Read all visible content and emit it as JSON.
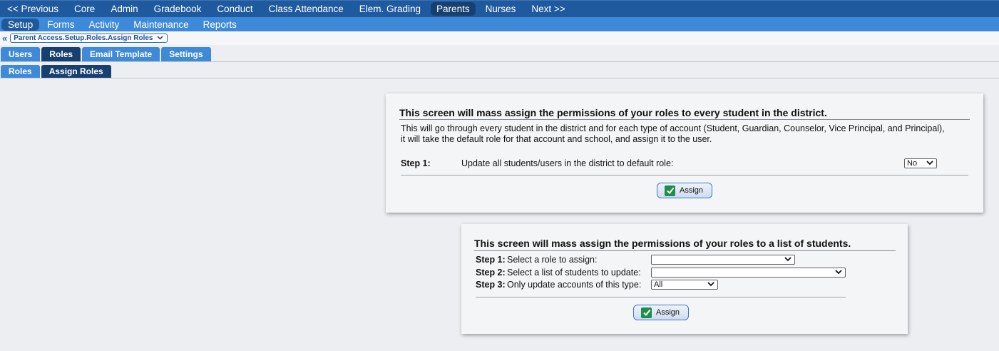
{
  "top_nav": {
    "items": [
      "<< Previous",
      "Core",
      "Admin",
      "Gradebook",
      "Conduct",
      "Class Attendance",
      "Elem. Grading",
      "Parents",
      "Nurses",
      "Next >>"
    ],
    "active": "Parents"
  },
  "sub_nav": {
    "items": [
      "Setup",
      "Forms",
      "Activity",
      "Maintenance",
      "Reports"
    ],
    "active": "Setup"
  },
  "breadcrumb": {
    "path": "Parent Access.Setup.Roles.Assign Roles"
  },
  "tabs": {
    "primary": [
      "Users",
      "Roles",
      "Email Template",
      "Settings"
    ],
    "primary_active": "Roles",
    "secondary": [
      "Roles",
      "Assign Roles"
    ],
    "secondary_active": "Assign Roles"
  },
  "panel1": {
    "title": "This screen will mass assign the permissions of your roles to every student in the district.",
    "desc_line1": "This will go through every student in the district and for each type of account (Student, Guardian, Counselor, Vice Principal, and Principal),",
    "desc_line2": "it will take the default role for that account and school, and assign it to the user.",
    "step1_label": "Step 1:",
    "step1_text": "Update all students/users in the district to default role:",
    "step1_value": "No",
    "assign_label": "Assign"
  },
  "panel2": {
    "title": "This screen will mass assign the permissions of your roles to a list of students.",
    "step1_label": "Step 1:",
    "step1_text": "Select a role to assign:",
    "step1_value": "",
    "step2_label": "Step 2:",
    "step2_text": "Select a list of students to update:",
    "step2_value": "",
    "step3_label": "Step 3:",
    "step3_text": "Only update accounts of this type:",
    "step3_value": "All",
    "assign_label": "Assign"
  },
  "colors": {
    "nav_primary": "#1f5a9e",
    "nav_secondary": "#3f8ad8",
    "nav_active": "#173f6f",
    "check_green": "#1f8e4a"
  }
}
